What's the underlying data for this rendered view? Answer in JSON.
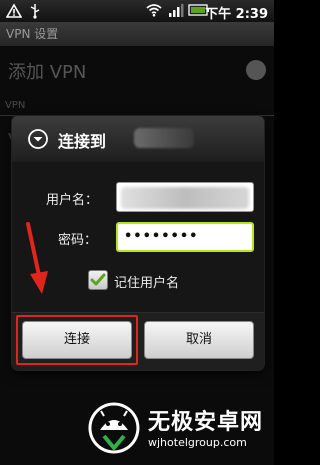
{
  "status_bar": {
    "time_text": "下午 2:39",
    "icons": [
      "warning-icon",
      "usb-icon",
      "wifi-icon",
      "signal-icon",
      "battery-icon"
    ]
  },
  "title_bar": {
    "title": "VPN 设置"
  },
  "background": {
    "add_vpn_label": "添加 VPN",
    "vpn_header": "VPN",
    "row_letter": "V"
  },
  "dialog": {
    "title": "连接到",
    "username_label": "用户名：",
    "password_label": "密码：",
    "password_value": "••••••••",
    "remember_label": "记住用户名",
    "remember_checked": true,
    "connect_label": "连接",
    "cancel_label": "取消"
  },
  "watermark": {
    "title": "无极安卓网",
    "url": "wjhotelgroup.com"
  },
  "colors": {
    "annotation": "#e0261c",
    "password_focus": "#b5e61d",
    "checkmark": "#5ea31f"
  }
}
